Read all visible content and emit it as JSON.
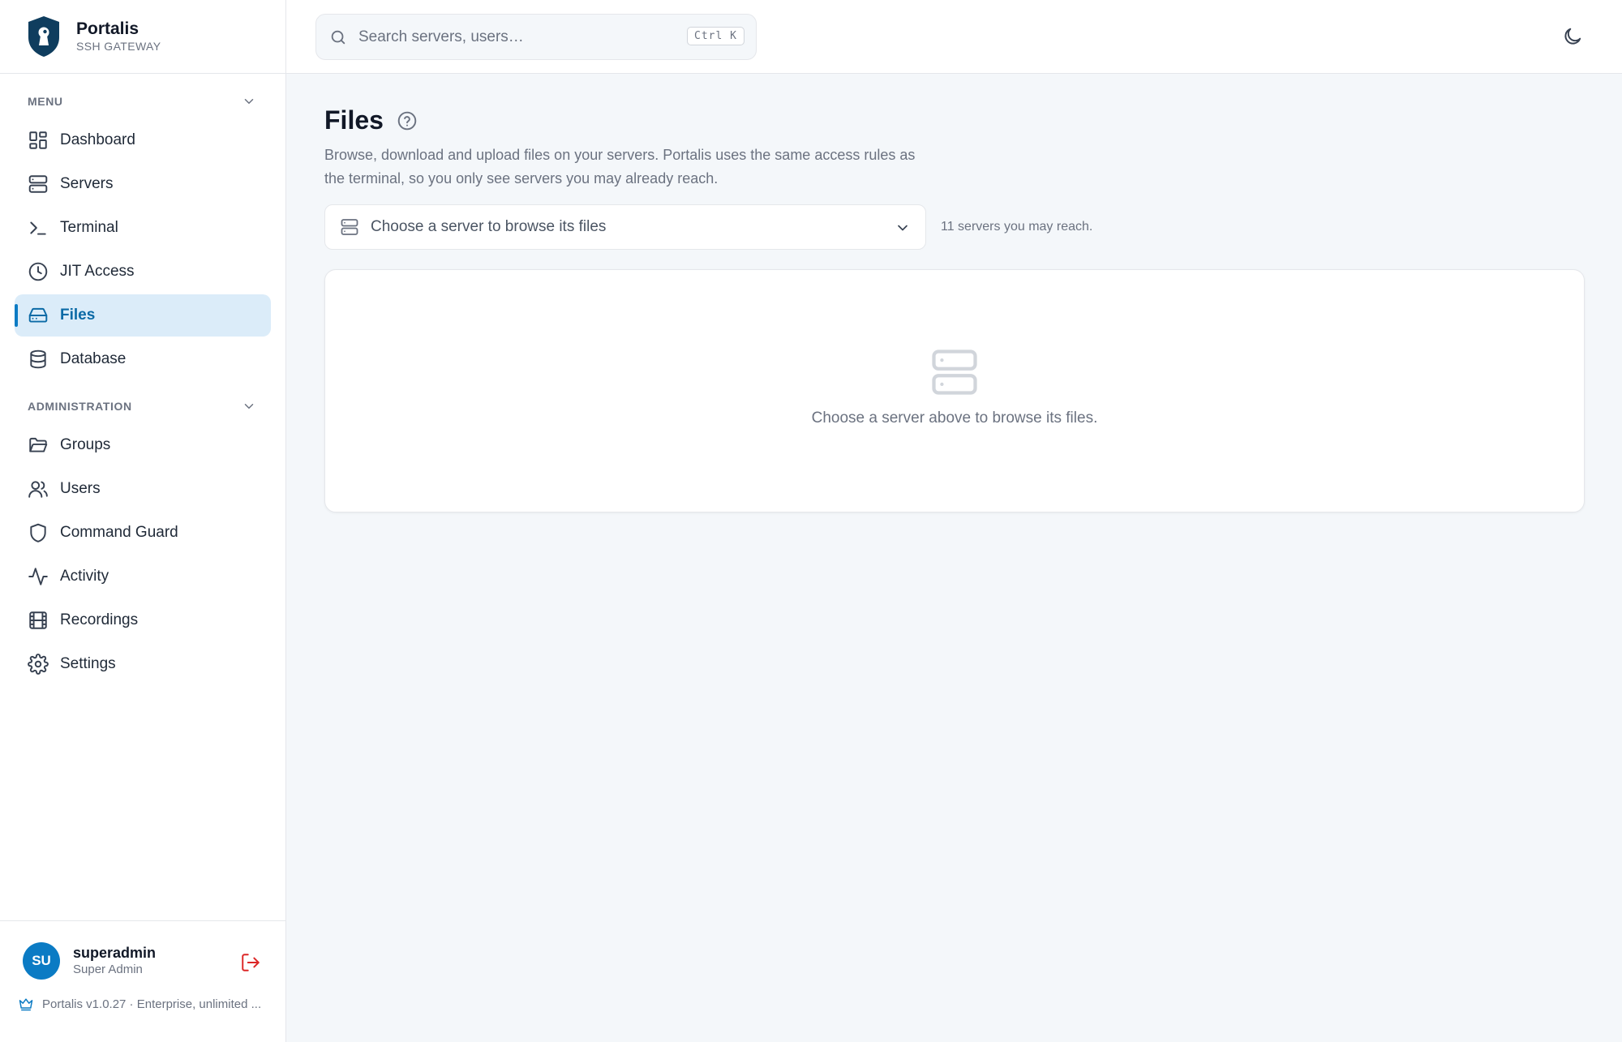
{
  "brand": {
    "name": "Portalis",
    "subtitle": "SSH GATEWAY"
  },
  "sidebar": {
    "menu_label": "MENU",
    "admin_label": "ADMINISTRATION",
    "menu_items": [
      {
        "label": "Dashboard",
        "icon": "dashboard-icon"
      },
      {
        "label": "Servers",
        "icon": "server-icon"
      },
      {
        "label": "Terminal",
        "icon": "terminal-icon"
      },
      {
        "label": "JIT Access",
        "icon": "clock-icon"
      },
      {
        "label": "Files",
        "icon": "hard-drive-icon",
        "active": true
      },
      {
        "label": "Database",
        "icon": "database-icon"
      }
    ],
    "admin_items": [
      {
        "label": "Groups",
        "icon": "folder-icon"
      },
      {
        "label": "Users",
        "icon": "users-icon"
      },
      {
        "label": "Command Guard",
        "icon": "shield-icon"
      },
      {
        "label": "Activity",
        "icon": "activity-icon"
      },
      {
        "label": "Recordings",
        "icon": "film-icon"
      },
      {
        "label": "Settings",
        "icon": "gear-icon"
      }
    ],
    "user": {
      "initials": "SU",
      "name": "superadmin",
      "role": "Super Admin"
    },
    "version": "Portalis v1.0.27 · Enterprise, unlimited ..."
  },
  "topbar": {
    "search_placeholder": "Search servers, users…",
    "shortcut": "Ctrl K"
  },
  "main": {
    "title": "Files",
    "description": "Browse, download and upload files on your servers. Portalis uses the same access rules as the terminal, so you only see servers you may already reach.",
    "server_select_placeholder": "Choose a server to browse its files",
    "server_count": "11 servers you may reach.",
    "empty_message": "Choose a server above to browse its files."
  },
  "colors": {
    "accent": "#0b7bc4",
    "active_bg": "#dbecf9",
    "logout": "#dc2626",
    "page_bg": "#f4f7fa"
  }
}
